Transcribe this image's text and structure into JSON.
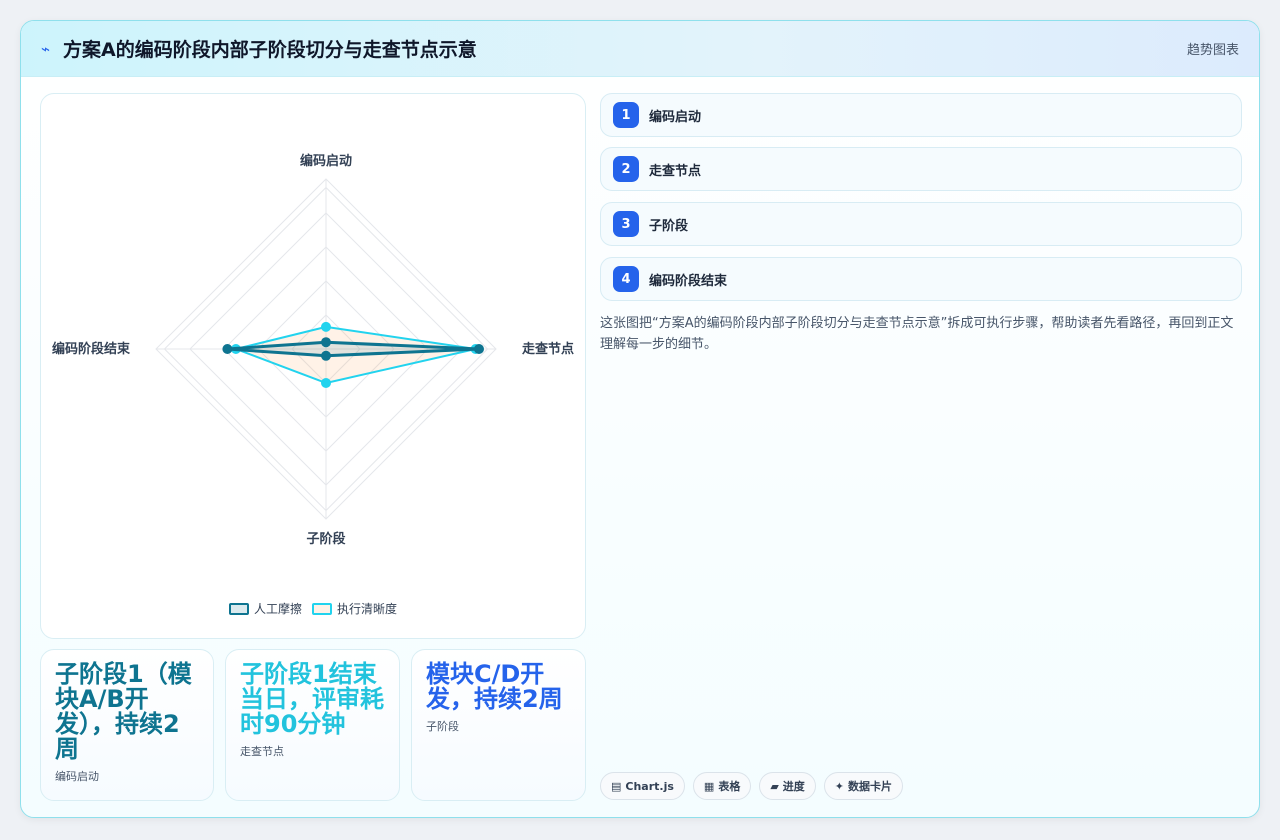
{
  "header": {
    "title": "方案A的编码阶段内部子阶段切分与走查节点示意",
    "right_label": "趋势图表",
    "icon": "chart-line-icon"
  },
  "chart_data": {
    "type": "radar",
    "title": "",
    "axes": [
      "编码启动",
      "走查节点",
      "子阶段",
      "编码阶段结束"
    ],
    "range": [
      0,
      100
    ],
    "grid": true,
    "legend": "bottom",
    "series": [
      {
        "name": "人工摩擦",
        "values": [
          4,
          90,
          4,
          58
        ],
        "color": "#0e7490",
        "fill": "rgba(14,116,144,0.12)"
      },
      {
        "name": "执行清晰度",
        "values": [
          13,
          88,
          20,
          53
        ],
        "color": "#22d3ee",
        "fill": "rgba(251,146,60,0.12)"
      }
    ]
  },
  "stats": [
    {
      "value": "子阶段1（模块A/B开发），持续2周",
      "label": "编码启动",
      "color": "#0e7490"
    },
    {
      "value": "子阶段1结束当日，评审耗时90分钟",
      "label": "走查节点",
      "color": "#22c3dd"
    },
    {
      "value": "模块C/D开发，持续2周",
      "label": "子阶段",
      "color": "#2563eb"
    }
  ],
  "steps": [
    {
      "num": "1",
      "label": "编码启动"
    },
    {
      "num": "2",
      "label": "走查节点"
    },
    {
      "num": "3",
      "label": "子阶段"
    },
    {
      "num": "4",
      "label": "编码阶段结束"
    }
  ],
  "description": "这张图把“方案A的编码阶段内部子阶段切分与走查节点示意”拆成可执行步骤，帮助读者先看路径，再回到正文理解每一步的细节。",
  "tags": [
    {
      "icon": "▤",
      "label": "Chart.js"
    },
    {
      "icon": "▦",
      "label": "表格"
    },
    {
      "icon": "▰",
      "label": "进度"
    },
    {
      "icon": "✦",
      "label": "数据卡片"
    }
  ]
}
